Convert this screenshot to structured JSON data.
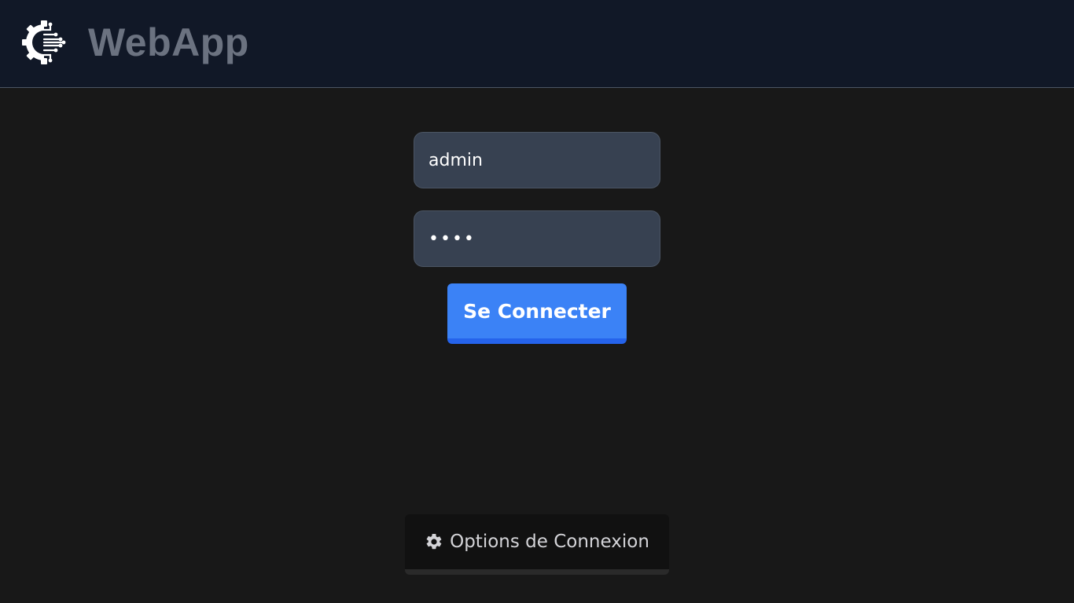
{
  "header": {
    "logo_icon": "circuit-gear-logo-icon",
    "title": "WebApp",
    "title_color": "#6b7280",
    "background": "#111827"
  },
  "login": {
    "username_value": "admin",
    "password_value": "abcd",
    "submit_label": "Se Connecter",
    "accent_color": "#3b82f6"
  },
  "footer": {
    "options_icon": "gear-icon",
    "options_label": "Options de Connexion"
  }
}
